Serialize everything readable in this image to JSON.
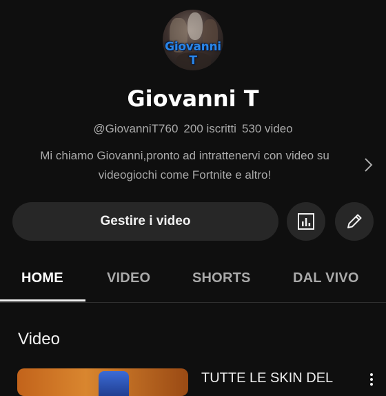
{
  "channel": {
    "avatar_text": "Giovanni T",
    "name": "Giovanni T",
    "handle": "@GiovanniT760",
    "subscribers": "200 iscritti",
    "videos_count": "530 video",
    "description_line1": "Mi chiamo Giovanni,pronto ad intrattenervi con video su",
    "description_line2": "videogiochi come Fortnite e altro!"
  },
  "actions": {
    "manage_label": "Gestire i video",
    "analytics_icon": "analytics-icon",
    "edit_icon": "pencil-icon"
  },
  "tabs": [
    {
      "label": "HOME",
      "active": true
    },
    {
      "label": "VIDEO",
      "active": false
    },
    {
      "label": "SHORTS",
      "active": false
    },
    {
      "label": "DAL VIVO",
      "active": false
    }
  ],
  "section": {
    "title": "Video"
  },
  "videos": [
    {
      "title": "TUTTE LE SKIN DEL"
    }
  ],
  "colors": {
    "background": "#0f0f0f",
    "button": "#272727",
    "text_primary": "#f1f1f1",
    "text_secondary": "#aaaaaa"
  }
}
